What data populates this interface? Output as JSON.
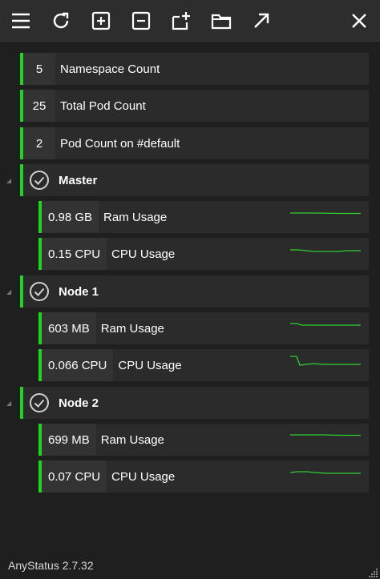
{
  "toolbar": {
    "buttons": [
      "menu-icon",
      "refresh-icon",
      "add-icon",
      "remove-icon",
      "add-folder-icon",
      "folder-icon",
      "open-external-icon",
      "close-icon"
    ]
  },
  "summary": [
    {
      "value": "5",
      "label": "Namespace Count"
    },
    {
      "value": "25",
      "label": "Total Pod Count"
    },
    {
      "value": "2",
      "label": "Pod Count on #default"
    }
  ],
  "nodes": [
    {
      "name": "Master",
      "ram": {
        "value": "0.98 GB",
        "label": "Ram Usage"
      },
      "cpu": {
        "value": "0.15 CPU",
        "label": "CPU Usage"
      }
    },
    {
      "name": "Node 1",
      "ram": {
        "value": "603 MB",
        "label": "Ram Usage"
      },
      "cpu": {
        "value": "0.066 CPU",
        "label": "CPU Usage"
      }
    },
    {
      "name": "Node 2",
      "ram": {
        "value": "699 MB",
        "label": "Ram Usage"
      },
      "cpu": {
        "value": "0.07 CPU",
        "label": "CPU Usage"
      }
    }
  ],
  "colors": {
    "accent": "#21d421",
    "spark": "#2fd02f",
    "background": "#1f1f1f",
    "row": "#2b2b2b"
  },
  "footer": {
    "app_version": "AnyStatus 2.7.32"
  }
}
